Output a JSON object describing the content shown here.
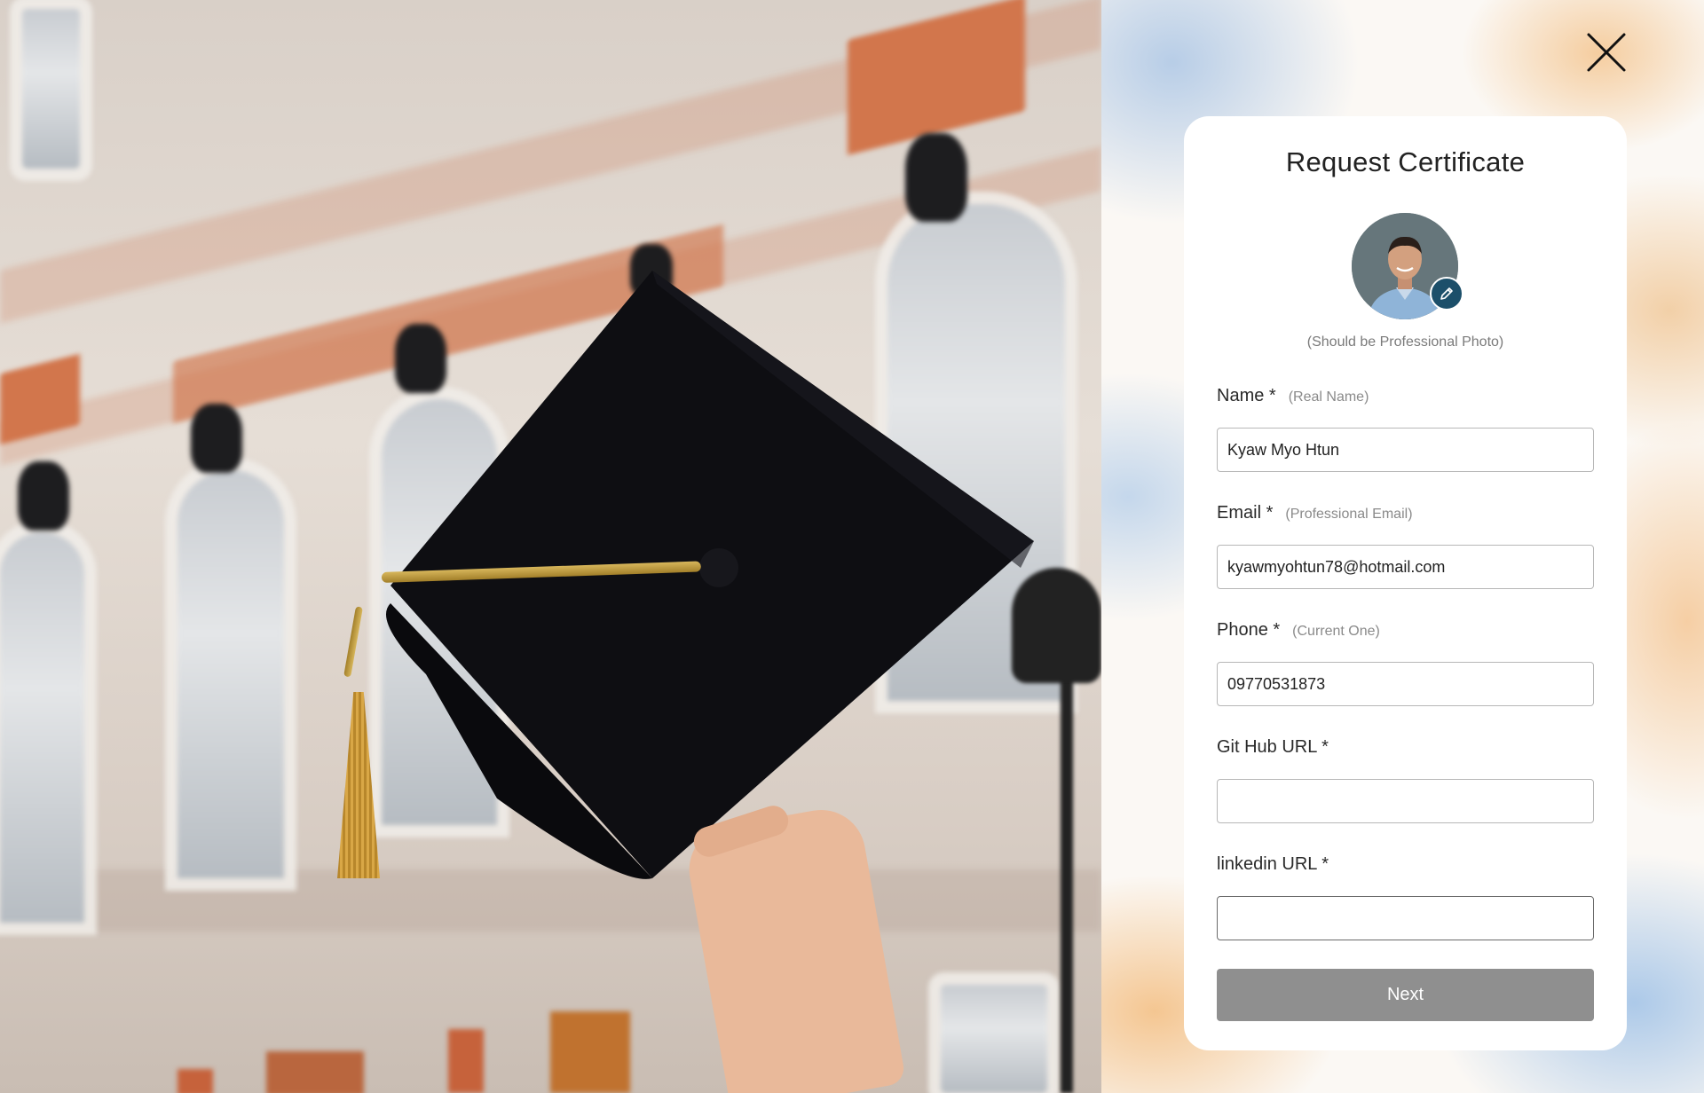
{
  "form": {
    "title": "Request Certificate",
    "photo_note": "(Should be Professional Photo)",
    "fields": [
      {
        "label": "Name *",
        "hint": "(Real Name)",
        "value": "Kyaw Myo Htun"
      },
      {
        "label": "Email *",
        "hint": "(Professional Email)",
        "value": "kyawmyohtun78@hotmail.com"
      },
      {
        "label": "Phone *",
        "hint": "(Current One)",
        "value": "09770531873"
      },
      {
        "label": "Git Hub URL *",
        "hint": "",
        "value": ""
      },
      {
        "label": "linkedin URL *",
        "hint": "",
        "value": ""
      }
    ],
    "next_label": "Next"
  },
  "icons": {
    "close": "close-icon",
    "edit": "pencil-icon"
  },
  "colors": {
    "edit_button": "#1c4f6a",
    "next_button": "#8f8f8f",
    "card": "#ffffff"
  }
}
